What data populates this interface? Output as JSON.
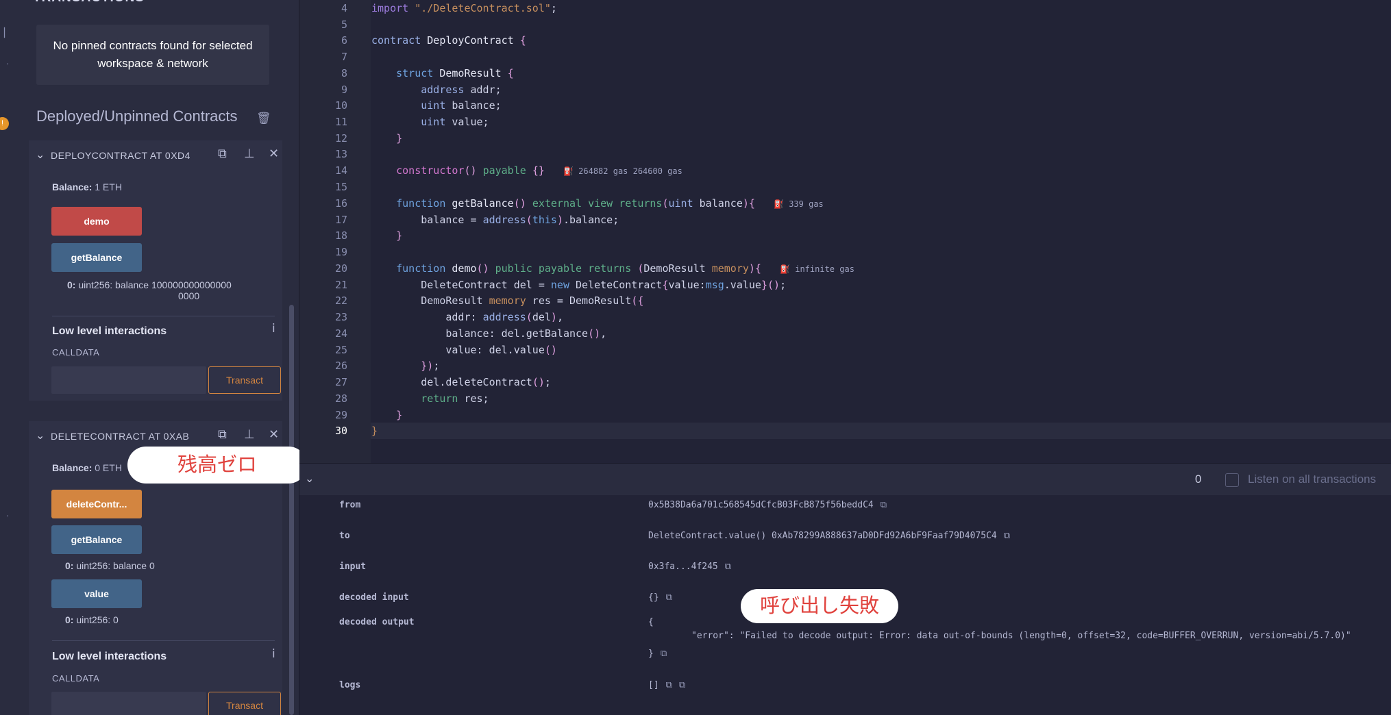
{
  "left_panel": {
    "header": "TRANSACTIONS",
    "no_pinned": "No pinned contracts found for selected workspace & network",
    "deployed_title": "Deployed/Unpinned Contracts",
    "contracts": [
      {
        "title": "DEPLOYCONTRACT AT 0XD4",
        "balance_label": "Balance:",
        "balance_value": "1 ETH",
        "buttons": [
          "demo",
          "getBalance"
        ],
        "output_index": "0:",
        "output_text": "uint256: balance 100000000000000",
        "output_text_2": "0000",
        "low_level": "Low level interactions",
        "calldata": "CALLDATA",
        "transact": "Transact"
      },
      {
        "title": "DELETECONTRACT AT 0XAB",
        "balance_label": "Balance:",
        "balance_value": "0 ETH",
        "buttons": [
          "deleteContr...",
          "getBalance",
          "value"
        ],
        "output_getbalance_index": "0:",
        "output_getbalance": "uint256: balance 0",
        "output_value_index": "0:",
        "output_value": "uint256: 0",
        "low_level": "Low level interactions",
        "calldata": "CALLDATA",
        "transact": "Transact"
      }
    ]
  },
  "annotations": {
    "zero_balance": "残高ゼロ",
    "call_failed": "呼び出し失敗"
  },
  "editor": {
    "current_line": "30",
    "lines": [
      {
        "n": "4"
      },
      {
        "n": "5"
      },
      {
        "n": "6"
      },
      {
        "n": "7"
      },
      {
        "n": "8"
      },
      {
        "n": "9"
      },
      {
        "n": "10"
      },
      {
        "n": "11"
      },
      {
        "n": "12"
      },
      {
        "n": "13"
      },
      {
        "n": "14"
      },
      {
        "n": "15"
      },
      {
        "n": "16"
      },
      {
        "n": "17"
      },
      {
        "n": "18"
      },
      {
        "n": "19"
      },
      {
        "n": "20"
      },
      {
        "n": "21"
      },
      {
        "n": "22"
      },
      {
        "n": "23"
      },
      {
        "n": "24"
      },
      {
        "n": "25"
      },
      {
        "n": "26"
      },
      {
        "n": "27"
      },
      {
        "n": "28"
      },
      {
        "n": "29"
      },
      {
        "n": "30"
      }
    ],
    "gas_14": "264882 gas 264600 gas",
    "gas_16": "339 gas",
    "gas_20": "infinite gas"
  },
  "terminal": {
    "count": "0",
    "listen_label": "Listen on all transactions",
    "rows": {
      "from_key": "from",
      "from_val": "0x5B38Da6a701c568545dCfcB03FcB875f56beddC4",
      "to_key": "to",
      "to_val": "DeleteContract.value() 0xAb78299A888637aD0DFd92A6bF9Faaf79D4075C4",
      "input_key": "input",
      "input_val": "0x3fa...4f245",
      "decoded_input_key": "decoded input",
      "decoded_input_val": "{}",
      "decoded_output_key": "decoded output",
      "decoded_output_open": "{",
      "decoded_output_error": "\"error\": \"Failed to decode output: Error: data out-of-bounds (length=0, offset=32, code=BUFFER_OVERRUN, version=abi/5.7.0)\"",
      "decoded_output_close": "}",
      "logs_key": "logs",
      "logs_val": "[]"
    }
  },
  "colors": {
    "accent_orange": "#d38540",
    "button_red": "#c14a48",
    "button_blue": "#426488",
    "annotation_red": "#e0423d"
  }
}
